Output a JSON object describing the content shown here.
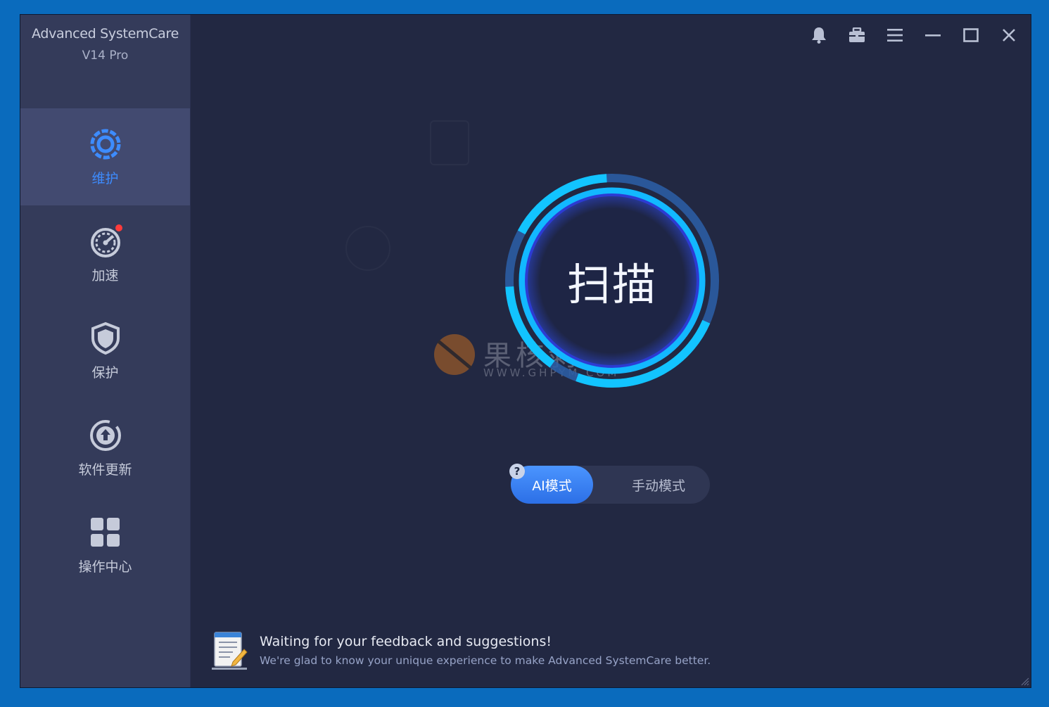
{
  "app": {
    "name": "Advanced SystemCare",
    "version": "V14 Pro"
  },
  "sidebar": {
    "items": [
      {
        "label": "维护",
        "icon": "maintenance-icon",
        "active": true
      },
      {
        "label": "加速",
        "icon": "speedometer-icon",
        "badge": true
      },
      {
        "label": "保护",
        "icon": "shield-icon"
      },
      {
        "label": "软件更新",
        "icon": "software-update-icon"
      },
      {
        "label": "操作中心",
        "icon": "action-center-grid-icon"
      }
    ]
  },
  "topbar": {
    "icons": [
      "bell-icon",
      "toolbox-icon",
      "menu-icon",
      "minimize-icon",
      "maximize-icon",
      "close-icon"
    ]
  },
  "scan": {
    "label": "扫描"
  },
  "mode": {
    "help": "?",
    "ai_label": "AI模式",
    "manual_label": "手动模式",
    "selected": "AI模式"
  },
  "feedback": {
    "title": "Waiting for your feedback and suggestions!",
    "subtitle": "We're glad to know your unique experience to make Advanced SystemCare better."
  },
  "watermark": {
    "text": "果核剥壳",
    "url": "WWW.GHPYM.COM"
  },
  "colors": {
    "accent": "#3d8cff",
    "ring": "#12c4ff",
    "window_bg": "#222842",
    "sidebar_bg": "#343b5a",
    "desktop": "#0a6bbd",
    "badge": "#ff3b3b"
  }
}
